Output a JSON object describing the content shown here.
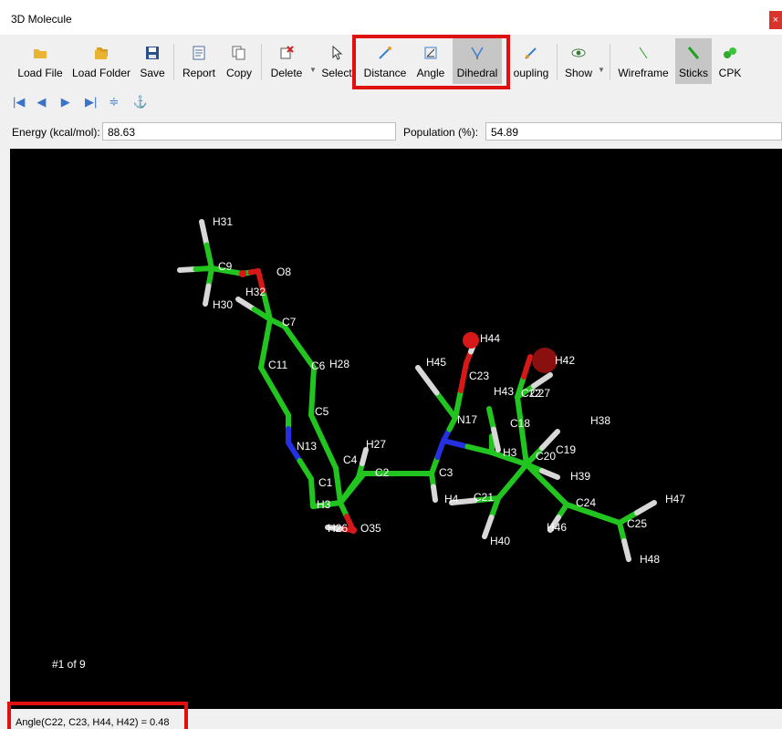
{
  "window": {
    "title": "3D Molecule",
    "close_label": "×"
  },
  "toolbar": {
    "buttons": [
      {
        "label": "Load File",
        "icon": "folder-icon"
      },
      {
        "label": "Load Folder",
        "icon": "folder-stack-icon"
      },
      {
        "label": "Save",
        "icon": "floppy-icon"
      },
      {
        "label": "Report",
        "icon": "report-icon"
      },
      {
        "label": "Copy",
        "icon": "copy-icon"
      },
      {
        "label": "Delete",
        "icon": "delete-icon"
      },
      {
        "label": "Select",
        "icon": "cursor-icon"
      },
      {
        "label": "Distance",
        "icon": "distance-icon"
      },
      {
        "label": "Angle",
        "icon": "angle-icon"
      },
      {
        "label": "Dihedral",
        "icon": "dihedral-icon",
        "active": true
      },
      {
        "label": "oupling",
        "icon": "coupling-icon"
      },
      {
        "label": "Show",
        "icon": "eye-icon"
      },
      {
        "label": "Wireframe",
        "icon": "wireframe-icon"
      },
      {
        "label": "Sticks",
        "icon": "sticks-icon",
        "active": true
      },
      {
        "label": "CPK",
        "icon": "cpk-icon"
      }
    ]
  },
  "nav": {
    "first": "first-frame-icon",
    "prev": "previous-frame-icon",
    "next": "next-frame-icon",
    "last": "last-frame-icon",
    "extra1": "align-icon",
    "extra2": "anchor-icon"
  },
  "fields": {
    "energy_label": "Energy (kcal/mol):",
    "energy_value": "88.63",
    "population_label": "Population (%):",
    "population_value": "54.89"
  },
  "viewer": {
    "frame_label": "#1 of 9",
    "atom_labels": [
      "H31",
      "C9",
      "O8",
      "H32",
      "H30",
      "C7",
      "C11",
      "C6",
      "H28",
      "C5",
      "N13",
      "H27",
      "C4",
      "C2",
      "C3",
      "C1",
      "H3",
      "H26",
      "O35",
      "N17",
      "H45",
      "C23",
      "H44",
      "H43",
      "C22",
      "C27",
      "H42",
      "H38",
      "C18",
      "C19",
      "H3",
      "C20",
      "H39",
      "C21",
      "H4",
      "H40",
      "C24",
      "H47",
      "C25",
      "H46",
      "H48"
    ],
    "colors": {
      "carbon": "#22c51f",
      "hydrogen": "#d8d8d8",
      "oxygen": "#d61818",
      "nitrogen": "#2530e0",
      "background": "#000000"
    }
  },
  "status": {
    "text": "Angle(C22, C23, H44, H42) = 0.48"
  },
  "accent": {
    "highlight": "#e01010"
  }
}
